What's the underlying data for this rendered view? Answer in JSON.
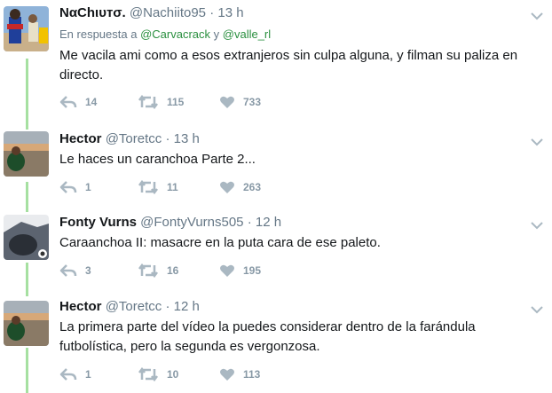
{
  "colors": {
    "thread": "#a6e0a1",
    "muted": "#657786",
    "link": "#2a8f3f",
    "icon": "#aab8c2"
  },
  "tweets": [
    {
      "name": "NαChιυтσ.",
      "handle": "@Nachiito95",
      "dot": "·",
      "time": "13 h",
      "reply_prefix": "En respuesta a",
      "reply_user1": "@Carvacrack",
      "reply_and": "y",
      "reply_user2": "@valle_rl",
      "text": "Me vacila ami como a esos extranjeros sin culpa alguna, y filman su paliza en directo.",
      "replies": "14",
      "retweets": "115",
      "likes": "733"
    },
    {
      "name": "Hector",
      "handle": "@Toretcc",
      "dot": "·",
      "time": "13 h",
      "text": "Le haces un caranchoa Parte 2...",
      "replies": "1",
      "retweets": "11",
      "likes": "263"
    },
    {
      "name": "Fonty Vurns",
      "handle": "@FontyVurns505",
      "dot": "·",
      "time": "12 h",
      "text": "Caraanchoa II: masacre en la puta cara de ese paleto.",
      "replies": "3",
      "retweets": "16",
      "likes": "195"
    },
    {
      "name": "Hector",
      "handle": "@Toretcc",
      "dot": "·",
      "time": "12 h",
      "text": "La primera parte del vídeo la puedes considerar dentro de la farándula futbolística, pero la segunda es vergonzosa.",
      "replies": "1",
      "retweets": "10",
      "likes": "113"
    }
  ]
}
